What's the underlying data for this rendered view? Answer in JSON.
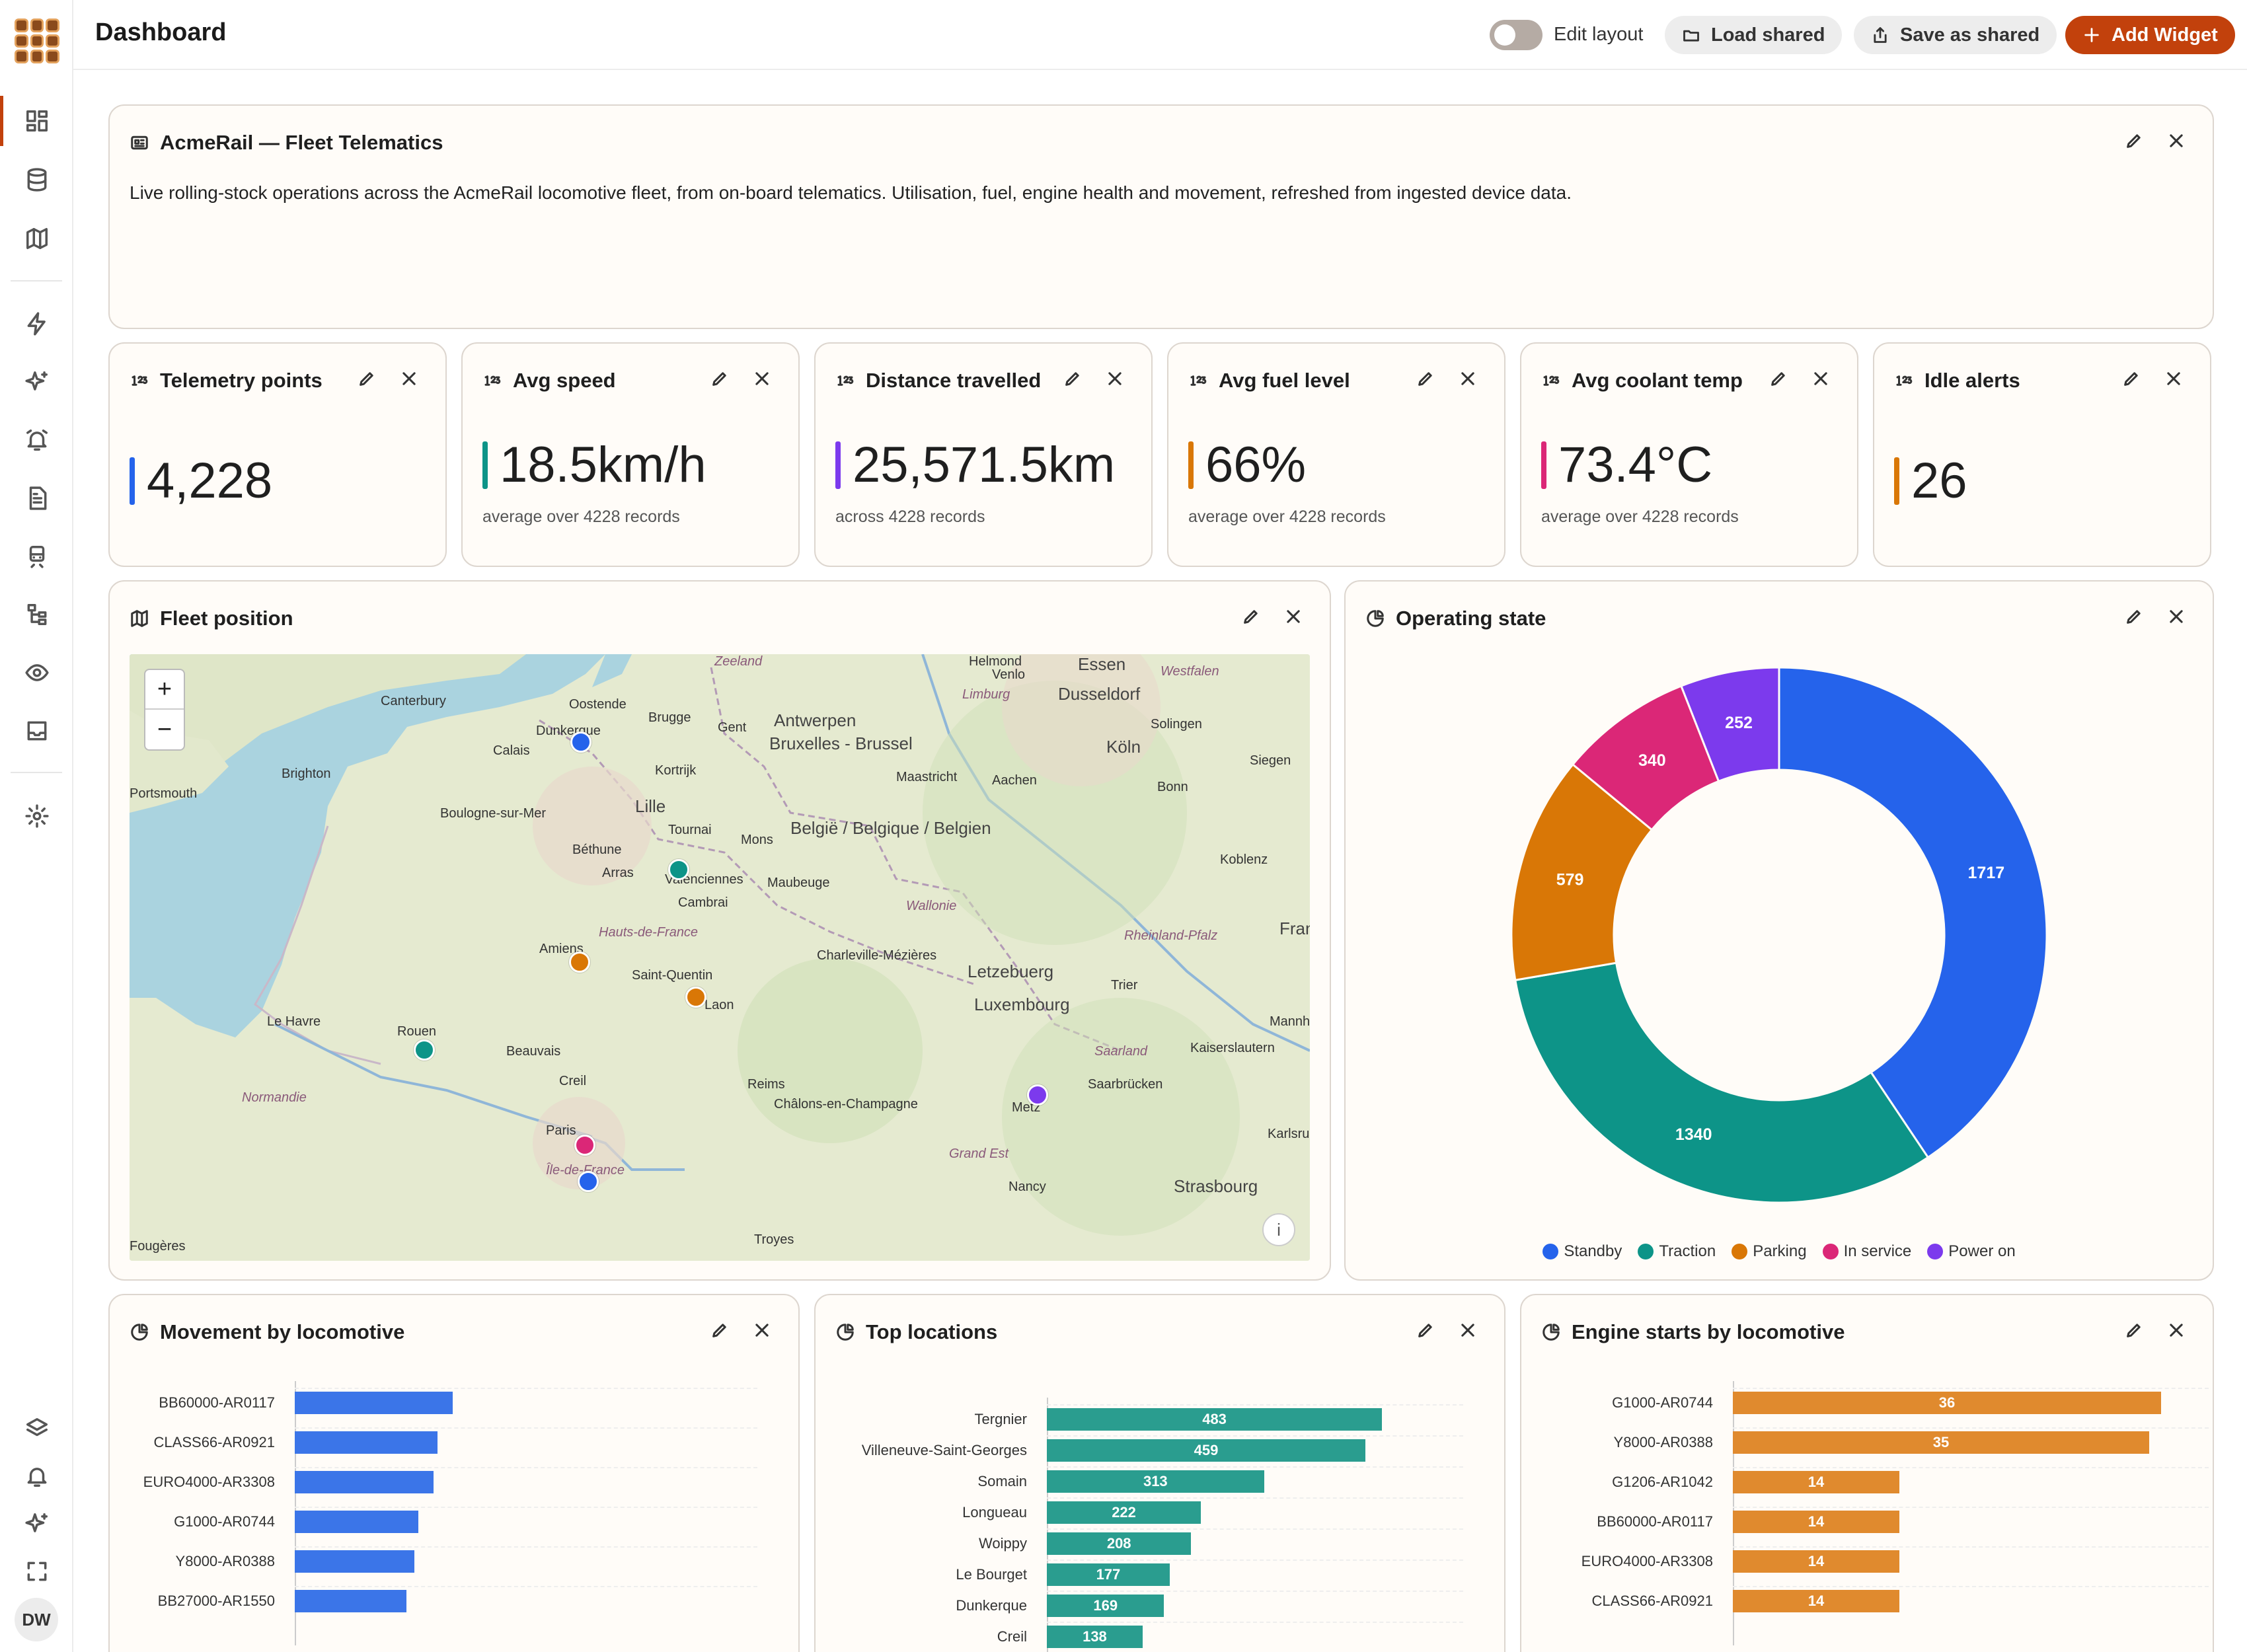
{
  "header": {
    "title": "Dashboard",
    "edit_layout_label": "Edit layout",
    "load_shared_label": "Load shared",
    "save_shared_label": "Save as shared",
    "add_widget_label": "Add Widget"
  },
  "sidebar": {
    "avatar_initials": "DW",
    "items": [
      "dashboard-icon",
      "database-icon",
      "map-icon",
      "bolt-icon",
      "sparkles-icon",
      "alarm-icon",
      "document-icon",
      "train-icon",
      "hierarchy-icon",
      "eye-icon",
      "inbox-icon",
      "gear-icon"
    ],
    "bottom_items": [
      "layers-icon",
      "bell-icon",
      "sparkles-icon",
      "fullscreen-icon"
    ]
  },
  "info_card": {
    "title": "AcmeRail — Fleet Telematics",
    "description": "Live rolling-stock operations across the AcmeRail locomotive fleet, from on-board telematics. Utilisation, fuel, engine health and movement, refreshed from ingested device data."
  },
  "kpis": [
    {
      "title": "Telemetry points",
      "value": "4,228",
      "sub": "",
      "color": "#2563eb"
    },
    {
      "title": "Avg speed",
      "value": "18.5km/h",
      "sub": "average over 4228 records",
      "color": "#0d9488"
    },
    {
      "title": "Distance travelled",
      "value": "25,571.5km",
      "sub": "across 4228 records",
      "color": "#7c3aed"
    },
    {
      "title": "Avg fuel level",
      "value": "66%",
      "sub": "average over 4228 records",
      "color": "#d97706"
    },
    {
      "title": "Avg coolant temp",
      "value": "73.4°C",
      "sub": "average over 4228 records",
      "color": "#db2777"
    },
    {
      "title": "Idle alerts",
      "value": "26",
      "sub": "",
      "color": "#d97706"
    }
  ],
  "map_card": {
    "title": "Fleet position",
    "zoom_in": "+",
    "zoom_out": "−",
    "info": "i",
    "cities": [
      {
        "name": "Canterbury",
        "cls": ""
      },
      {
        "name": "Brighton",
        "cls": ""
      },
      {
        "name": "Calais",
        "cls": ""
      },
      {
        "name": "Dunkerque",
        "cls": ""
      },
      {
        "name": "Oostende",
        "cls": ""
      },
      {
        "name": "Brugge",
        "cls": ""
      },
      {
        "name": "Gent",
        "cls": ""
      },
      {
        "name": "Antwerpen",
        "cls": "big"
      },
      {
        "name": "Bruxelles - Brussel",
        "cls": "big"
      },
      {
        "name": "Boulogne-sur-Mer",
        "cls": ""
      },
      {
        "name": "Kortrijk",
        "cls": ""
      },
      {
        "name": "Lille",
        "cls": "big"
      },
      {
        "name": "Tournai",
        "cls": ""
      },
      {
        "name": "Mons",
        "cls": ""
      },
      {
        "name": "Béthune",
        "cls": ""
      },
      {
        "name": "Arras",
        "cls": ""
      },
      {
        "name": "Valenciennes",
        "cls": ""
      },
      {
        "name": "Maubeuge",
        "cls": ""
      },
      {
        "name": "Cambrai",
        "cls": ""
      },
      {
        "name": "Maastricht",
        "cls": ""
      },
      {
        "name": "Aachen",
        "cls": ""
      },
      {
        "name": "Essen",
        "cls": "big"
      },
      {
        "name": "Venlo",
        "cls": ""
      },
      {
        "name": "Dusseldorf",
        "cls": "big"
      },
      {
        "name": "Solingen",
        "cls": ""
      },
      {
        "name": "Köln",
        "cls": "big"
      },
      {
        "name": "Bonn",
        "cls": ""
      },
      {
        "name": "Siegen",
        "cls": ""
      },
      {
        "name": "Koblenz",
        "cls": ""
      },
      {
        "name": "België / Belgique / Belgien",
        "cls": "big"
      },
      {
        "name": "Wallonie",
        "cls": "region"
      },
      {
        "name": "Hauts-de-France",
        "cls": "region"
      },
      {
        "name": "Amiens",
        "cls": ""
      },
      {
        "name": "Saint-Quentin",
        "cls": ""
      },
      {
        "name": "Laon",
        "cls": ""
      },
      {
        "name": "Charleville-Mézières",
        "cls": ""
      },
      {
        "name": "Letzebuerg",
        "cls": "big"
      },
      {
        "name": "Luxembourg",
        "cls": "big"
      },
      {
        "name": "Trier",
        "cls": ""
      },
      {
        "name": "Rheinland-Pfalz",
        "cls": "region"
      },
      {
        "name": "Le Havre",
        "cls": ""
      },
      {
        "name": "Rouen",
        "cls": ""
      },
      {
        "name": "Beauvais",
        "cls": ""
      },
      {
        "name": "Creil",
        "cls": ""
      },
      {
        "name": "Reims",
        "cls": ""
      },
      {
        "name": "Châlons-en-Champagne",
        "cls": ""
      },
      {
        "name": "Metz",
        "cls": ""
      },
      {
        "name": "Saarbrücken",
        "cls": ""
      },
      {
        "name": "Saarland",
        "cls": "region"
      },
      {
        "name": "Kaiserslautern",
        "cls": ""
      },
      {
        "name": "Normandie",
        "cls": "region"
      },
      {
        "name": "Paris",
        "cls": ""
      },
      {
        "name": "Île-de-France",
        "cls": "region"
      },
      {
        "name": "Grand Est",
        "cls": "region"
      },
      {
        "name": "Nancy",
        "cls": ""
      },
      {
        "name": "Strasbourg",
        "cls": "big"
      },
      {
        "name": "Troyes",
        "cls": ""
      },
      {
        "name": "Limburg",
        "cls": "region"
      },
      {
        "name": "Westfalen",
        "cls": "region"
      },
      {
        "name": "Karlsru",
        "cls": ""
      },
      {
        "name": "Mannh",
        "cls": ""
      },
      {
        "name": "Fran",
        "cls": "big"
      },
      {
        "name": "Helmond",
        "cls": ""
      },
      {
        "name": "Zeeland",
        "cls": "region"
      },
      {
        "name": "Portsmouth",
        "cls": ""
      },
      {
        "name": "Fougères",
        "cls": ""
      }
    ],
    "markers": [
      {
        "color": "#2563eb"
      },
      {
        "color": "#0d9488"
      },
      {
        "color": "#d97706"
      },
      {
        "color": "#d97706"
      },
      {
        "color": "#0d9488"
      },
      {
        "color": "#7c3aed"
      },
      {
        "color": "#db2777"
      },
      {
        "color": "#2563eb"
      }
    ]
  },
  "donut_card": {
    "title": "Operating state",
    "chart_data": {
      "type": "pie",
      "categories": [
        "Standby",
        "Traction",
        "Parking",
        "In service",
        "Power on"
      ],
      "values": [
        1717,
        1340,
        579,
        340,
        252
      ],
      "colors": [
        "#2563eb",
        "#0d9488",
        "#d97706",
        "#db2777",
        "#7c3aed"
      ],
      "legend": "bottom"
    }
  },
  "movement_card": {
    "title": "Movement by locomotive",
    "chart_data": {
      "type": "bar",
      "categories": [
        "BB60000-AR0117",
        "CLASS66-AR0921",
        "EURO4000-AR3308",
        "G1000-AR0744",
        "Y8000-AR0388",
        "BB27000-AR1550"
      ],
      "values": [
        41,
        37,
        36,
        32,
        31,
        29
      ],
      "xlim": [
        0,
        120
      ],
      "color": "#3b75e8",
      "show_values": false
    }
  },
  "locations_card": {
    "title": "Top locations",
    "chart_data": {
      "type": "bar",
      "categories": [
        "Tergnier",
        "Villeneuve-Saint-Georges",
        "Somain",
        "Longueau",
        "Woippy",
        "Le Bourget",
        "Dunkerque",
        "Creil"
      ],
      "values": [
        483,
        459,
        313,
        222,
        208,
        177,
        169,
        138
      ],
      "labels": [
        "483",
        "459",
        "313",
        "222",
        "208",
        "177",
        "169",
        "138"
      ],
      "xlim": [
        0,
        600
      ],
      "color": "#2a9d8f",
      "show_values": true
    }
  },
  "engine_card": {
    "title": "Engine starts by locomotive",
    "chart_data": {
      "type": "bar",
      "categories": [
        "G1000-AR0744",
        "Y8000-AR0388",
        "G1206-AR1042",
        "BB60000-AR0117",
        "EURO4000-AR3308",
        "CLASS66-AR0921"
      ],
      "values": [
        36,
        35,
        14,
        14,
        14,
        14
      ],
      "labels": [
        "36",
        "35",
        "14",
        "14",
        "14",
        "14"
      ],
      "xlim": [
        0,
        40
      ],
      "color": "#e08a2e",
      "show_values": true
    }
  }
}
